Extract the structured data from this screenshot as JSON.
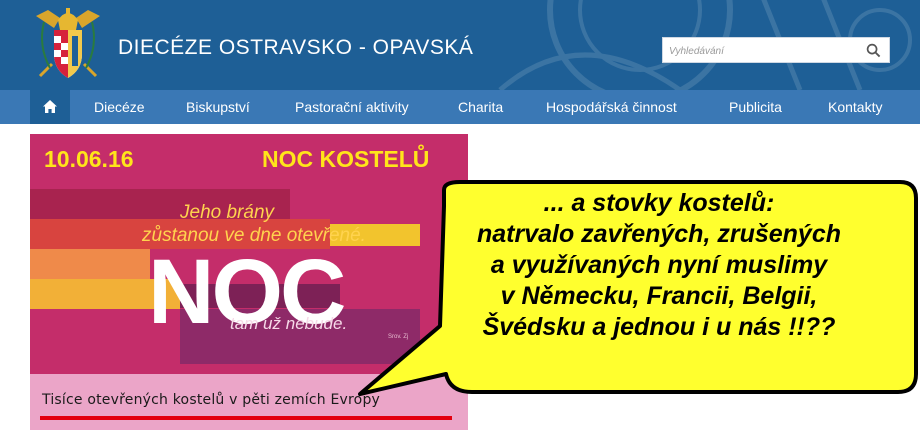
{
  "site": {
    "title": "DIECÉZE OSTRAVSKO - OPAVSKÁ",
    "search_placeholder": "Vyhledávání"
  },
  "nav": {
    "items": [
      {
        "label": "Diecéze"
      },
      {
        "label": "Biskupství"
      },
      {
        "label": "Pastorační aktivity"
      },
      {
        "label": "Charita"
      },
      {
        "label": "Hospodářská činnost"
      },
      {
        "label": "Publicita"
      },
      {
        "label": "Kontakty"
      }
    ]
  },
  "banner": {
    "date": "10.06.16",
    "event": "NOC KOSTELŮ",
    "line1": "Jeho brány",
    "line2": "zůstanou ve dne otevřené.",
    "big_word": "NOC",
    "line3": "tam už nebude.",
    "fine_print": "Srov. Zj",
    "caption": "Tisíce otevřených kostelů v pěti zemích Evropy"
  },
  "bubble": {
    "lines": [
      "... a stovky kostelů:",
      "natrvalo zavřených, zrušených",
      "a využívaných nyní muslimy",
      "v Německu, Francii, Belgii,",
      "Švédsku a jednou i u nás !!??"
    ]
  },
  "colors": {
    "header_bg": "#1e5f96",
    "nav_bg": "#3a78b5",
    "banner_magenta": "#c42d6a",
    "banner_yellow": "#ffe51a",
    "bubble_fill": "#ffff2e",
    "underline_red": "#e3000f"
  },
  "icons": {
    "logo": "diocese-crest-icon",
    "search": "search-icon",
    "home": "home-icon"
  }
}
